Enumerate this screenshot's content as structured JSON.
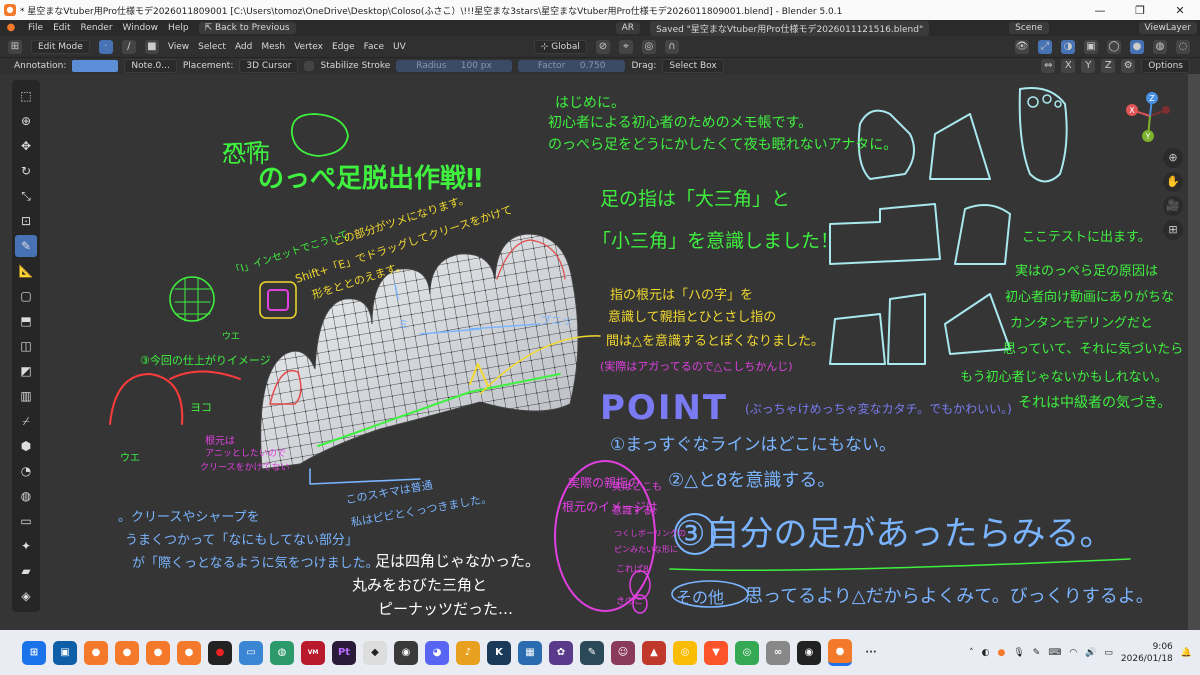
{
  "titlebar": {
    "title": "* 星空まなVtuber用Pro仕様モデ2026011809001 [C:\\Users\\tomoz\\OneDrive\\Desktop\\Coloso(ふさこ）\\!!!星空まな3stars\\星空まなVtuber用Pro仕様モデ2026011809001.blend] - Blender 5.0.1",
    "controls": [
      "—",
      "❐",
      "✕"
    ]
  },
  "menubar": {
    "items": [
      "File",
      "Edit",
      "Render",
      "Window",
      "Help"
    ],
    "back_button": "Back to Previous",
    "ar": "AR",
    "saved": "Saved \"星空まなVtuber用Pro仕様モデ2026011121516.blend\"",
    "scene": "Scene",
    "view_layer": "ViewLayer"
  },
  "header": {
    "mode": "Edit Mode",
    "menus": [
      "View",
      "Select",
      "Add",
      "Mesh",
      "Vertex",
      "Edge",
      "Face",
      "UV"
    ],
    "transform": "Global"
  },
  "tool_options": {
    "annotation_label": "Annotation:",
    "note": "Note.0...",
    "placement_label": "Placement:",
    "placement_value": "3D Cursor",
    "stabilize": "Stabilize Stroke",
    "radius_label": "Radius",
    "radius_value": "100 px",
    "factor_label": "Factor",
    "factor_value": "0.750",
    "drag_label": "Drag:",
    "drag_value": "Select Box",
    "axes": [
      "X",
      "Y",
      "Z"
    ],
    "options": "Options"
  },
  "gizmo": {
    "x": "X",
    "y": "Y",
    "z": "Z"
  },
  "annotations": {
    "title_left": "恐怖",
    "title_main": "のっぺ足脱出作戦‼",
    "intro_1": "はじめに。",
    "intro_2": "初心者による初心者のためのメモ帳です。",
    "intro_3": "のっぺら足をどうにかしたくて夜も眠れないアナタに。",
    "daisankaku": "足の指は「大三角」と",
    "shousankaku": "「小三角」を意識しました！",
    "inset_note": "「I」インセットでこうして",
    "nail_note": "この部分がツメになります。",
    "shift_e": "Shift+「E」でドラッグしてクリースをかけて",
    "katachi": "形をととのえます。",
    "ue_1": "ウエ",
    "ue_2": "ウエ",
    "yoko": "ヨコ",
    "shiage": "③今回の仕上がりイメージ",
    "nemoto_1": "根元は",
    "nemoto_2": "アニッとしたいので",
    "nemoto_3": "クリースをかけてない",
    "arrow_1": "ミ",
    "arrow_2": "プニッ",
    "hachi_1": "指の根元は「ハの字」を",
    "hachi_2": "意識して親指とひとさし指の",
    "hachi_3": "間は△を意識するとぽくなりました。",
    "hachi_4": "(実際はアガってるので△こしちかんじ)",
    "test": "ここテストに出ます。",
    "genin_1": "実はのっぺら足の原因は",
    "genin_2": "初心者向け動画にありがちな",
    "genin_3": "カンタンモデリングだと",
    "genin_4": "思っていて、それに気づいたら",
    "genin_5": "もう初心者じゃないかもしれない。",
    "genin_6": "それは中級者の気づき。",
    "point": "POINT",
    "point_note": "(ぶっちゃけめっちゃ変なカタチ。でもかわいい。)",
    "p1": "①まっすぐなラインはどこにもない。",
    "p2": "②△と8を意識する。",
    "p3": "③自分の足があったらみる。",
    "p4_circle": "その他",
    "p4": "思ってるより△だからよくみて。びっくりするよ。",
    "sukima_1": "このスキマは普通",
    "sukima_2": "私はピビとくっつきました。",
    "crease_1": "。クリースやシャープを",
    "crease_2": "うまくつかって「なにもしてない部分」",
    "crease_3": "が「際くっとなるように気をつけました。",
    "shikaku_1": "足は四角じゃなかった。",
    "shikaku_2": "丸みをおびた三角と",
    "shikaku_3": "ピーナッツだった…",
    "oyayubi_1": "実際の親指の",
    "oyayubi_2": "根元のイメージは",
    "jitsu_1": "実はここも",
    "jitsu_2": "意識する。",
    "jitsu_3": "つくしボーリングの",
    "jitsu_4": "ピンみたいな形に",
    "jitsu_5": "これば8",
    "jitsu_6": "きのこ"
  },
  "taskbar": {
    "clock_time": "9:06",
    "clock_date": "2026/01/18"
  },
  "colors": {
    "accent": "#4772b3",
    "note_green": "#3ff03f",
    "note_blue": "#7ab4ff",
    "note_yellow": "#f2d930",
    "note_magenta": "#e040e0",
    "note_red": "#ff3b3b",
    "note_cyan": "#a8e8ee"
  }
}
